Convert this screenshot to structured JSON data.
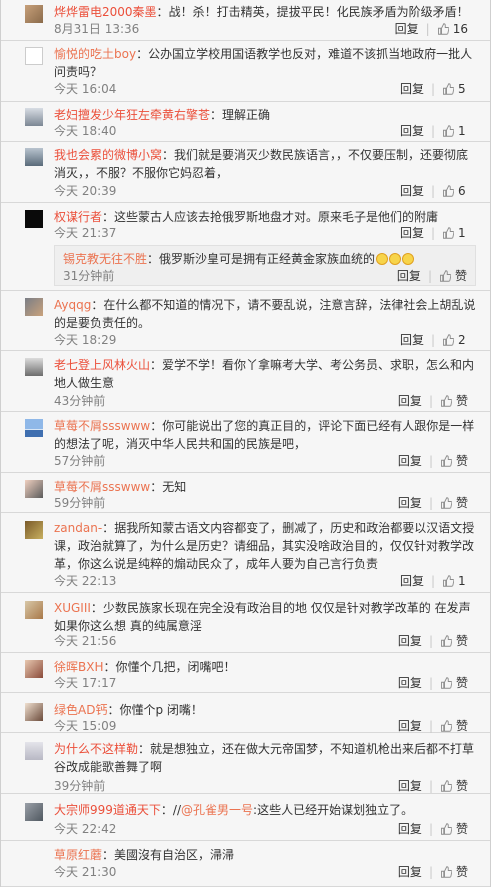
{
  "ui": {
    "reply_label": "回复",
    "separator": "|",
    "like_label": "赞"
  },
  "comments": [
    {
      "name": "烨烨雷电2000秦墨",
      "sep": "：",
      "text": "战！杀！打击精英，提拔平民！化民族矛盾为阶级矛盾！",
      "time": "8月31日 13:36",
      "likes": "16",
      "avatar_icon": "user-avatar"
    },
    {
      "name": "愉悦的吃土boy",
      "sep": "：",
      "text": "公办国立学校用国语教学也反对，难道不该抓当地政府一批人问责吗？",
      "time": "今天 16:04",
      "likes": "5",
      "avatar_icon": "user-avatar"
    },
    {
      "name": "老妇擅发少年狂左牵黄右擎苍",
      "sep": "：",
      "text": "理解正确",
      "time": "今天 18:40",
      "likes": "1",
      "avatar_icon": "user-avatar"
    },
    {
      "name": "我也会累的微博小窝",
      "sep": "：",
      "text": "我们就是要消灭少数民族语言，，不仅要压制，还要彻底消灭，，不服？不服你它妈忍着，",
      "time": "今天 20:39",
      "likes": "6",
      "avatar_icon": "user-avatar"
    },
    {
      "name": "权谋行者",
      "sep": "：",
      "text": "这些蒙古人应该去抢俄罗斯地盘才对。原来毛子是他们的附庸",
      "time": "今天 21:37",
      "likes": "1",
      "avatar_icon": "user-avatar",
      "sub": {
        "name": "锡克教无往不胜",
        "sep": "：",
        "text": "俄罗斯沙皇可是拥有正经黄金家族血统的",
        "emoji_count": 3,
        "time": "31分钟前",
        "likes": "赞"
      }
    },
    {
      "name": "Ayqqg",
      "sep": "：",
      "text": "在什么都不知道的情况下，请不要乱说，注意言辞，法律社会上胡乱说的是要负责任的。",
      "time": "今天 18:29",
      "likes": "2",
      "avatar_icon": "user-avatar"
    },
    {
      "name": "老七登上风林火山",
      "sep": "：",
      "text": "爱学不学！看你丫拿嘛考大学、考公务员、求职，怎么和内地人做生意",
      "time": "43分钟前",
      "likes": "赞",
      "avatar_icon": "user-avatar"
    },
    {
      "name": "草莓不屑ssswww",
      "sep": "：",
      "text": "你可能说出了您的真正目的，评论下面已经有人跟你是一样的想法了呢，消灭中华人民共和国的民族是吧，",
      "time": "57分钟前",
      "likes": "赞",
      "avatar_icon": "user-avatar"
    },
    {
      "name": "草莓不屑ssswww",
      "sep": "：",
      "text": "无知",
      "time": "59分钟前",
      "likes": "赞",
      "avatar_icon": "user-avatar"
    },
    {
      "name": "zandan-",
      "sep": "：",
      "text": "据我所知蒙古语文内容都变了，删减了，历史和政治都要以汉语文授课，政治就算了，为什么是历史？请细品，其实没啥政治目的，仅仅针对教学改革，你这么说是纯粹的煽动民众了，成年人要为自己言行负责",
      "time": "今天 22:13",
      "likes": "1",
      "avatar_icon": "user-avatar"
    },
    {
      "name": "XUGIII",
      "sep": "：",
      "text": "少数民族家长现在完全没有政治目的地 仅仅是针对教学改革的 在发声如果你这么想 真的纯属意淫",
      "time": "今天 21:56",
      "likes": "赞",
      "avatar_icon": "user-avatar"
    },
    {
      "name": "徐晖BXH",
      "sep": "：",
      "text": "你懂个几把，闭嘴吧！",
      "time": "今天 17:17",
      "likes": "赞",
      "avatar_icon": "user-avatar"
    },
    {
      "name": "绿色AD钙",
      "sep": "：",
      "text": "你懂个p 闭嘴！",
      "time": "今天 15:09",
      "likes": "赞",
      "avatar_icon": "user-avatar"
    },
    {
      "name": "为什么不这样勒",
      "sep": "：",
      "text": "就是想独立，还在做大元帝国梦，不知道机枪出来后都不打草谷改成能歌善舞了啊",
      "time": "39分钟前",
      "likes": "赞",
      "avatar_icon": "user-avatar"
    },
    {
      "name": "大宗师999道通天下",
      "sep": "：",
      "text": "//",
      "mention": "@孔雀男一号",
      "text2": ":这些人已经开始谋划独立了。",
      "time": "今天 22:42",
      "likes": "赞",
      "avatar_icon": "user-avatar"
    },
    {
      "name": "草原红蘑",
      "sep": "：",
      "text": "美國沒有自治区，㴆㴆",
      "time": "今天 21:30",
      "likes": "赞",
      "avatar_icon": "user-avatar"
    }
  ]
}
